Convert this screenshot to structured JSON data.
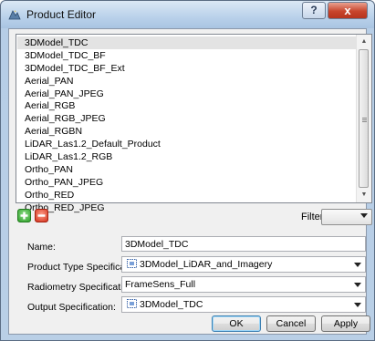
{
  "window": {
    "title": "Product Editor",
    "help_label": "?",
    "close_label": "x"
  },
  "products": {
    "items": [
      "3DModel_TDC",
      "3DModel_TDC_BF",
      "3DModel_TDC_BF_Ext",
      "Aerial_PAN",
      "Aerial_PAN_JPEG",
      "Aerial_RGB",
      "Aerial_RGB_JPEG",
      "Aerial_RGBN",
      "LiDAR_Las1.2_Default_Product",
      "LiDAR_Las1.2_RGB",
      "Ortho_PAN",
      "Ortho_PAN_JPEG",
      "Ortho_RED",
      "Ortho_RED_JPEG"
    ],
    "selected": "3DModel_TDC"
  },
  "filter": {
    "label": "Filter:",
    "value": ""
  },
  "form": {
    "name_label": "Name:",
    "name_value": "3DModel_TDC",
    "product_type_label": "Product Type Specification:",
    "product_type_value": "3DModel_LiDAR_and_Imagery",
    "radiometry_label": "Radiometry Specification:",
    "radiometry_value": "FrameSens_Full",
    "output_label": "Output Specification:",
    "output_value": "3DModel_TDC"
  },
  "buttons": {
    "ok": "OK",
    "cancel": "Cancel",
    "apply": "Apply"
  },
  "colors": {
    "add": "#2f9e2a",
    "remove": "#d2321c",
    "selection": "#e3e3e3",
    "titlebar": "#b9d1ea"
  }
}
